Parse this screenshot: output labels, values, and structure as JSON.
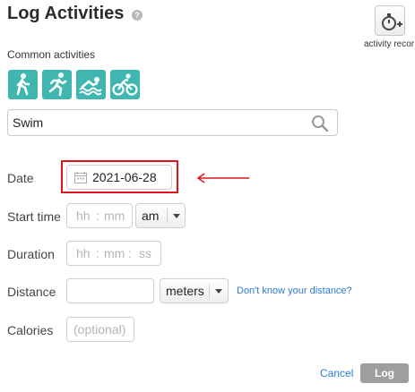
{
  "header": {
    "title": "Log Activities",
    "help_icon": "question-icon",
    "record_label": "activity recor"
  },
  "common_activities": {
    "label": "Common activities",
    "items": [
      "walk",
      "run",
      "swim",
      "bike"
    ]
  },
  "search": {
    "value": "Swim"
  },
  "form": {
    "date": {
      "label": "Date",
      "value": "2021-06-28"
    },
    "start_time": {
      "label": "Start time",
      "hh": "hh",
      "mm": "mm",
      "colon": ":",
      "ampm": "am"
    },
    "duration": {
      "label": "Duration",
      "hh": "hh",
      "mm": "mm",
      "ss": "ss",
      "colon": ":"
    },
    "distance": {
      "label": "Distance",
      "value": "",
      "unit": "meters",
      "help_link": "Don't know your distance?"
    },
    "calories": {
      "label": "Calories",
      "placeholder": "(optional)"
    }
  },
  "footer": {
    "cancel_label": "Cancel",
    "log_label": "Log"
  },
  "colors": {
    "accent": "#3fb7b0",
    "highlight": "#e0141e",
    "link": "#2a7ad6"
  }
}
